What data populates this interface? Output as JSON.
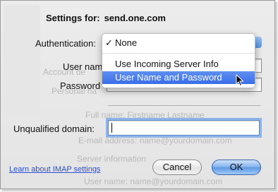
{
  "title": {
    "label": "Settings for:",
    "server": "send.one.com"
  },
  "fields": {
    "authentication": {
      "label": "Authentication:",
      "value": "None"
    },
    "user_name": {
      "label": "User name"
    },
    "password": {
      "label": "Password"
    },
    "unqualified_domain": {
      "label": "Unqualified domain:",
      "value": ""
    }
  },
  "menu": {
    "items": [
      {
        "label": "None",
        "checked": true,
        "highlighted": false
      },
      {
        "label": "Use Incoming Server Info",
        "checked": false,
        "highlighted": false
      },
      {
        "label": "User Name and Password",
        "checked": false,
        "highlighted": true
      }
    ],
    "check_mark": "✓"
  },
  "link": {
    "label": "Learn about IMAP settings"
  },
  "buttons": {
    "cancel": "Cancel",
    "ok": "OK"
  },
  "colors": {
    "highlight": "#3a6ee8",
    "link": "#2a4fd6",
    "default_button": "#5d98e2"
  }
}
